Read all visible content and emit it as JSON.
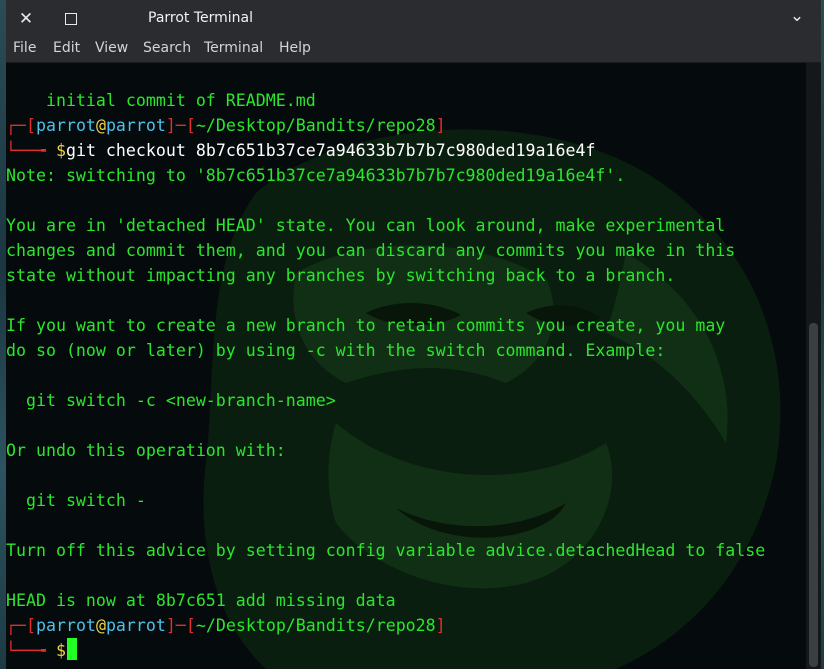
{
  "window": {
    "title": "Parrot Terminal",
    "close_glyph": "✕",
    "chevron_glyph": "⌄"
  },
  "menu": [
    "File",
    "Edit",
    "View",
    "Search",
    "Terminal",
    "Help"
  ],
  "terminal": {
    "prompt": {
      "corner": "┌─",
      "elbow": "└──╼",
      "open": "[",
      "user": "parrot",
      "at": "@",
      "host": "parrot",
      "close": "]",
      "sep": "─",
      "path": "~/Desktop/Bandits/repo28",
      "dollar": "$"
    },
    "lines": {
      "l0": "    initial commit of README.md",
      "cmd1": "git checkout 8b7c651b37ce7a94633b7b7b7c980ded19a16e4f",
      "l3": "Note: switching to '8b7c651b37ce7a94633b7b7b7c980ded19a16e4f'.",
      "l5": "You are in 'detached HEAD' state. You can look around, make experimental",
      "l6": "changes and commit them, and you can discard any commits you make in this",
      "l7": "state without impacting any branches by switching back to a branch.",
      "l9": "If you want to create a new branch to retain commits you create, you may",
      "l10": "do so (now or later) by using -c with the switch command. Example:",
      "l12": "  git switch -c <new-branch-name>",
      "l14": "Or undo this operation with:",
      "l16": "  git switch -",
      "l18": "Turn off this advice by setting config variable advice.detachedHead to false",
      "l20": "HEAD is now at 8b7c651 add missing data"
    }
  },
  "colors": {
    "text": "#2be62b",
    "prompt_frame": "#e02d2d",
    "user_host": "#4fc0e8",
    "at": "#f0d040",
    "titlebar": "#2a2c30",
    "background": "#050b0c"
  }
}
